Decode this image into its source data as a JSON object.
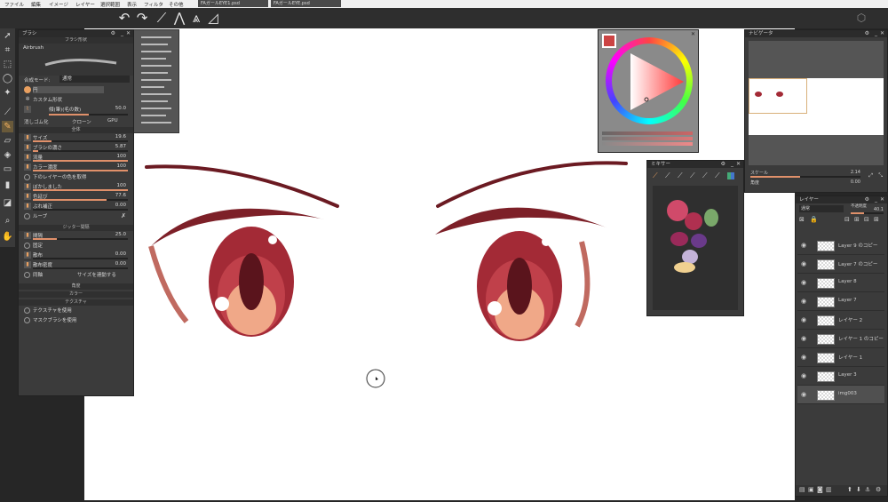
{
  "menu": {
    "items": [
      "ファイル",
      "編集",
      "イメージ",
      "レイヤー",
      "選択範囲",
      "表示",
      "フィルタ",
      "その他"
    ],
    "tabs": [
      "FAガールEYE1.psd",
      "FAガールEYE.psd"
    ]
  },
  "brush_panel": {
    "title": "ブラシ",
    "shape_header": "ブラシ形状",
    "brush_name": "Airbrush",
    "blend_label": "合成モード:",
    "blend_value": "通常",
    "shape_circle": "円",
    "custom_shape": "カスタム形状",
    "diameter_label": "傾(筆)(毛の数)",
    "diameter_value": "50.0",
    "blur_label": "消しゴム化",
    "clone_label": "クローン",
    "gpu_label": "GPU",
    "section_all": "全体",
    "params": [
      {
        "label": "サイズ",
        "value": "19.6",
        "fill": 0.2
      },
      {
        "label": "ブラシの濃さ",
        "value": "5.87",
        "fill": 0.06
      },
      {
        "label": "流量",
        "value": "100",
        "fill": 1.0
      },
      {
        "label": "カラー濃度",
        "value": "100",
        "fill": 1.0
      }
    ],
    "sample_label": "下のレイヤーの色を取得",
    "params2": [
      {
        "label": "ぼかしました",
        "value": "100",
        "fill": 1.0
      },
      {
        "label": "色延び",
        "value": "77.6",
        "fill": 0.78
      },
      {
        "label": "ぶれ補正",
        "value": "0.00",
        "fill": 0.0
      }
    ],
    "loop_label": "ループ",
    "section_jitter": "ジッター間隔",
    "jitter": [
      {
        "label": "間隔",
        "value": "25.0",
        "fill": 0.25
      }
    ],
    "fixed_label": "固定",
    "jitter2": [
      {
        "label": "散布",
        "value": "0.00",
        "fill": 0.0
      },
      {
        "label": "散布密度",
        "value": "0.00",
        "fill": 0.0
      }
    ],
    "sync_label": "同軸",
    "link_size_label": "サイズを連動する",
    "section_angle": "角度",
    "section_color": "カラー",
    "section_texture": "テクスチャ",
    "use_texture": "テクスチャを使用",
    "use_mask": "マスクブラシを使用"
  },
  "navigator": {
    "title": "ナビゲータ",
    "scale_label": "スケール",
    "scale_value": "2.14",
    "angle_label": "角度",
    "angle_value": "0.00"
  },
  "mixer": {
    "title": "ミキサー"
  },
  "layers": {
    "title": "レイヤー",
    "blend": "通常",
    "opacity_label": "不透明度",
    "opacity_value": "40.1",
    "items": [
      "Layer 9 のコピー",
      "Layer 7 のコピー",
      "Layer 8",
      "Layer 7",
      "レイヤー 2",
      "レイヤー 1 のコピー",
      "レイヤー 1",
      "Layer 3",
      "img003"
    ]
  },
  "colors": {
    "accent": "#e0906a",
    "canvas": "#ffffff",
    "panel": "#3b3b3b",
    "iris": "#8a1f2a",
    "lash": "#6b1a22"
  },
  "icons": [
    "undo-icon",
    "redo-icon",
    "brush-icon",
    "symmetry-icon",
    "perspective-icon",
    "ruler-icon",
    "eye-icon",
    "gear-icon",
    "close-icon"
  ]
}
